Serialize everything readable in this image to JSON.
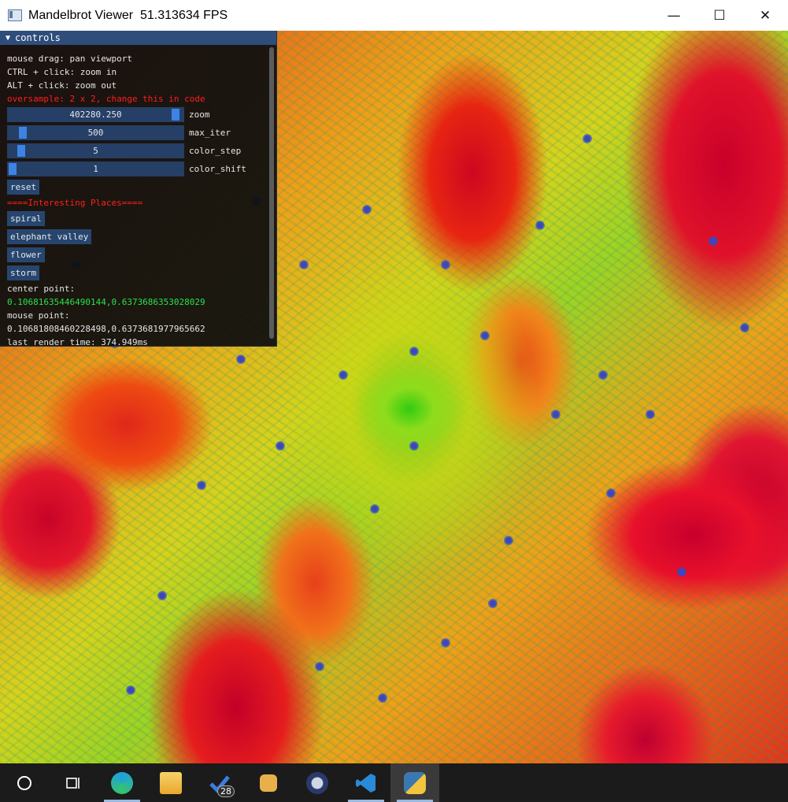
{
  "window": {
    "title": "Mandelbrot Viewer  51.313634 FPS",
    "minimize_glyph": "—",
    "maximize_glyph": "☐",
    "close_glyph": "✕"
  },
  "panel": {
    "header": "controls",
    "collapse_glyph": "▼",
    "help": [
      "mouse drag: pan viewport",
      "CTRL + click: zoom in",
      "ALT + click: zoom out"
    ],
    "oversample_note": "oversample: 2 x 2, change this in code",
    "sliders": [
      {
        "value": "402280.250",
        "label": "zoom",
        "level": 0.98
      },
      {
        "value": "500",
        "label": "max_iter",
        "level": 0.06
      },
      {
        "value": "5",
        "label": "color_step",
        "level": 0.05
      },
      {
        "value": "1",
        "label": "color_shift",
        "level": 0.0
      }
    ],
    "reset_label": "reset",
    "places_header": "====Interesting Places====",
    "places": [
      "spiral",
      "elephant valley",
      "flower",
      "storm"
    ],
    "center_label": "center point:",
    "center_value": "0.10681635446490144,0.6373686353028029",
    "mouse_label": "mouse point:",
    "mouse_value": "0.10681808460228498,0.637368197796566‌2",
    "render_time": "last render time: 374.949ms"
  },
  "taskbar": {
    "items": [
      {
        "name": "search-icon",
        "color": "#ffffff"
      },
      {
        "name": "task-view-icon",
        "color": "#ffffff"
      },
      {
        "name": "edge-icon",
        "color": "#1fa0e0"
      },
      {
        "name": "file-explorer-icon",
        "color": "#f5c542"
      },
      {
        "name": "todo-icon",
        "color": "#3b7de0",
        "badge": "28"
      },
      {
        "name": "chat-icon",
        "color": "#e8b04a"
      },
      {
        "name": "vpn-lock-icon",
        "color": "#cfd6e6"
      },
      {
        "name": "vscode-icon",
        "color": "#2a8ad8"
      },
      {
        "name": "python-icon",
        "color": "#f2c53d"
      }
    ]
  }
}
